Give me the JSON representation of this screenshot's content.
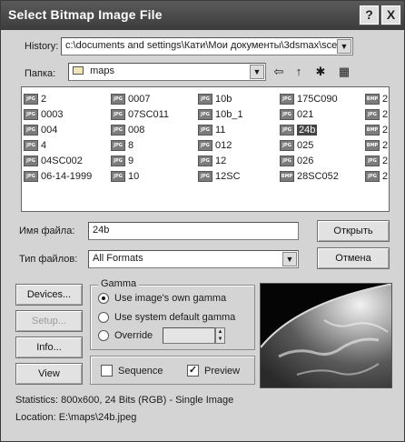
{
  "window": {
    "title": "Select Bitmap Image File"
  },
  "titlebar": {
    "help_label": "?",
    "close_label": "X"
  },
  "history": {
    "label": "History:",
    "value": "c:\\documents and settings\\Кати\\Мои документы\\3dsmax\\sce"
  },
  "folder": {
    "label": "Папка:",
    "value": "maps"
  },
  "toolbar": {
    "back_icon": "⇦",
    "up_icon": "↑",
    "newfolder_icon": "✱",
    "view_icon": "▦"
  },
  "files": {
    "columns": [
      [
        "2",
        "0003",
        "004",
        "4",
        "04SC002",
        "06-14-1999"
      ],
      [
        "0007",
        "07SC011",
        "008",
        "8",
        "9",
        "10"
      ],
      [
        "10b",
        "10b_1",
        "11",
        "012",
        "12",
        "12SC"
      ],
      [
        "175C090",
        "021",
        "24b",
        "025",
        "026",
        "28SC052"
      ],
      [
        "2",
        "2",
        "2",
        "2",
        "2",
        "2"
      ]
    ],
    "column_icons": [
      [
        "JPG",
        "JPG",
        "JPG",
        "JPG",
        "JPG",
        "JPG"
      ],
      [
        "JPG",
        "JPG",
        "JPG",
        "JPG",
        "JPG",
        "JPG"
      ],
      [
        "JPG",
        "JPG",
        "JPG",
        "JPG",
        "JPG",
        "JPG"
      ],
      [
        "JPG",
        "JPG",
        "JPG",
        "JPG",
        "JPG",
        "BMP"
      ],
      [
        "BMP",
        "JPG",
        "BMP",
        "BMP",
        "JPG",
        "JPG"
      ]
    ],
    "selected": "24b"
  },
  "filename": {
    "label": "Имя файла:",
    "value": "24b"
  },
  "filetype": {
    "label": "Тип файлов:",
    "value": "All Formats"
  },
  "buttons": {
    "open": "Открыть",
    "cancel": "Отмена",
    "devices": "Devices...",
    "setup": "Setup...",
    "info": "Info...",
    "view": "View"
  },
  "gamma": {
    "title": "Gamma",
    "own": "Use image's own gamma",
    "system": "Use system default gamma",
    "override": "Override",
    "override_value": ""
  },
  "options": {
    "sequence": "Sequence",
    "preview": "Preview",
    "preview_checked": "✓"
  },
  "stats": {
    "statistics": "Statistics:  800x600, 24 Bits (RGB) - Single Image",
    "location": "Location:  E:\\maps\\24b.jpeg"
  }
}
